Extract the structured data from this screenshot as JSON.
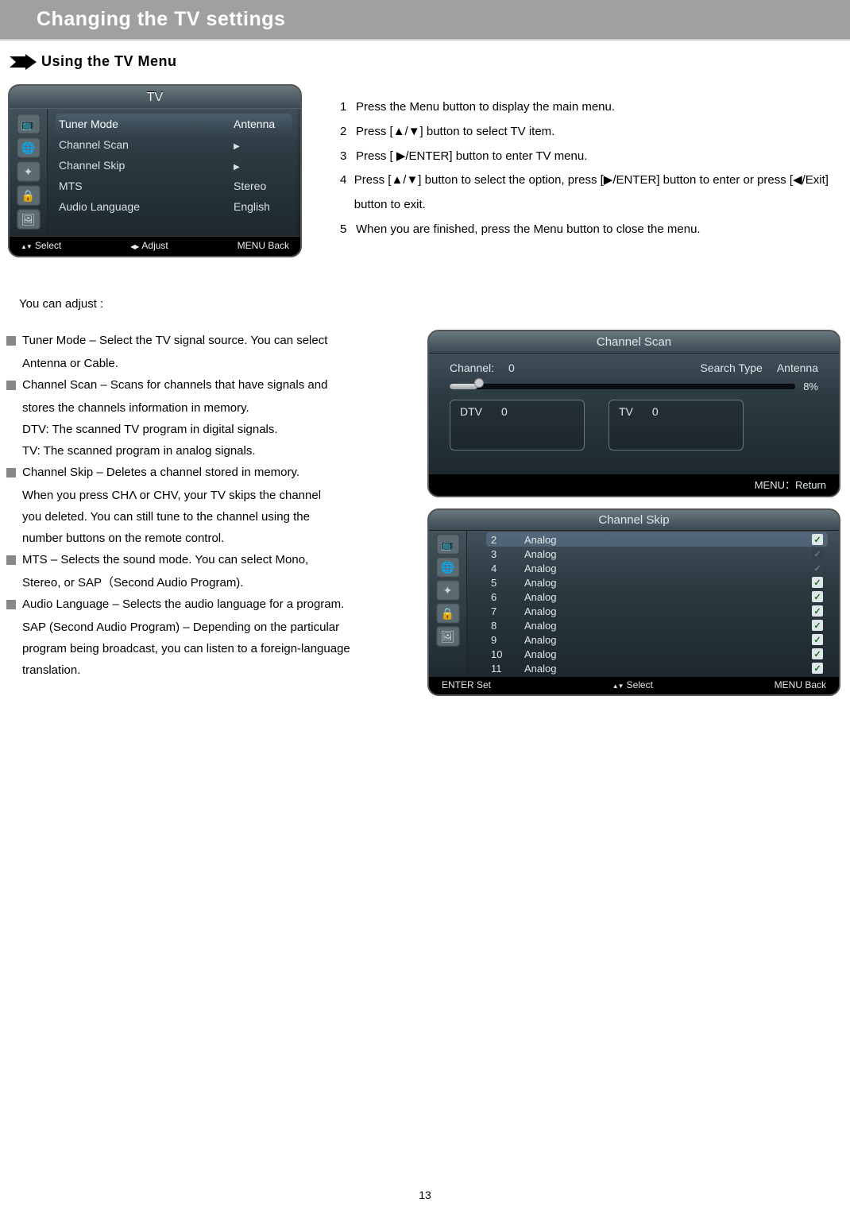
{
  "header": {
    "title": "Changing the TV settings"
  },
  "section": {
    "title": "Using the TV Menu"
  },
  "tv_osd": {
    "title": "TV",
    "rows": [
      {
        "label": "Tuner Mode",
        "value": "Antenna",
        "arrow": false,
        "selected": true
      },
      {
        "label": "Channel  Scan",
        "value": "",
        "arrow": true,
        "selected": false
      },
      {
        "label": "Channel  Skip",
        "value": "",
        "arrow": true,
        "selected": false
      },
      {
        "label": "MTS",
        "value": "Stereo",
        "arrow": false,
        "selected": false
      },
      {
        "label": "Audio  Language",
        "value": "English",
        "arrow": false,
        "selected": false
      }
    ],
    "footer": {
      "select": "Select",
      "adjust": "Adjust",
      "back": "MENU Back"
    }
  },
  "instructions": [
    "Press the Menu button to display the main menu.",
    "Press [▲/▼] button to select TV item.",
    "Press [ ▶/ENTER] button to enter TV menu.",
    "Press [▲/▼] button to select the option, press [▶/ENTER] button to enter or press [◀/Exit] button to exit.",
    "When you are finished, press the Menu button to close the menu."
  ],
  "adjust_intro": "You  can  adjust :",
  "descriptions": [
    {
      "head": "Tuner Mode – Select the TV signal source.  You can select",
      "lines": [
        "Antenna or Cable."
      ]
    },
    {
      "head": "Channel Scan – Scans for channels that have signals and",
      "lines": [
        "stores the channels information in memory.",
        "DTV: The scanned TV program in digital signals.",
        "TV: The scanned program in analog signals."
      ]
    },
    {
      "head": "Channel Skip – Deletes a channel stored in memory.",
      "lines": [
        "When you press CHΛ or CHV,  your TV skips the  channel",
        "you deleted.  You can still tune to the channel using the",
        "number buttons on the remote control."
      ]
    },
    {
      "head": "MTS – Selects the sound mode.  You can select Mono,",
      "lines": [
        "Stereo,  or SAP（Second Audio Program)."
      ]
    },
    {
      "head": "Audio Language – Selects the audio language for a program.",
      "lines": [
        "SAP (Second Audio Program) – Depending on the particular",
        "program being broadcast, you can listen to a foreign-language",
        "translation."
      ]
    }
  ],
  "scan": {
    "title": "Channel Scan",
    "channel_label": "Channel:",
    "channel_value": "0",
    "search_type_label": "Search Type",
    "search_type_value": "Antenna",
    "progress_pct": 8,
    "dtv_label": "DTV",
    "dtv_value": "0",
    "tv_label": "TV",
    "tv_value": "0",
    "footer": "MENU：Return"
  },
  "skip": {
    "title": "Channel Skip",
    "rows": [
      {
        "ch": "2",
        "type": "Analog",
        "checked": true,
        "selected": true,
        "dark": false
      },
      {
        "ch": "3",
        "type": "Analog",
        "checked": true,
        "selected": false,
        "dark": true
      },
      {
        "ch": "4",
        "type": "Analog",
        "checked": true,
        "selected": false,
        "dark": true
      },
      {
        "ch": "5",
        "type": "Analog",
        "checked": true,
        "selected": false,
        "dark": false
      },
      {
        "ch": "6",
        "type": "Analog",
        "checked": true,
        "selected": false,
        "dark": false
      },
      {
        "ch": "7",
        "type": "Analog",
        "checked": true,
        "selected": false,
        "dark": false
      },
      {
        "ch": "8",
        "type": "Analog",
        "checked": true,
        "selected": false,
        "dark": false
      },
      {
        "ch": "9",
        "type": "Analog",
        "checked": true,
        "selected": false,
        "dark": false
      },
      {
        "ch": "10",
        "type": "Analog",
        "checked": true,
        "selected": false,
        "dark": false
      },
      {
        "ch": "11",
        "type": "Analog",
        "checked": true,
        "selected": false,
        "dark": false
      }
    ],
    "footer": {
      "set": "ENTER Set",
      "select": "Select",
      "back": "MENU  Back"
    }
  },
  "page_number": "13"
}
